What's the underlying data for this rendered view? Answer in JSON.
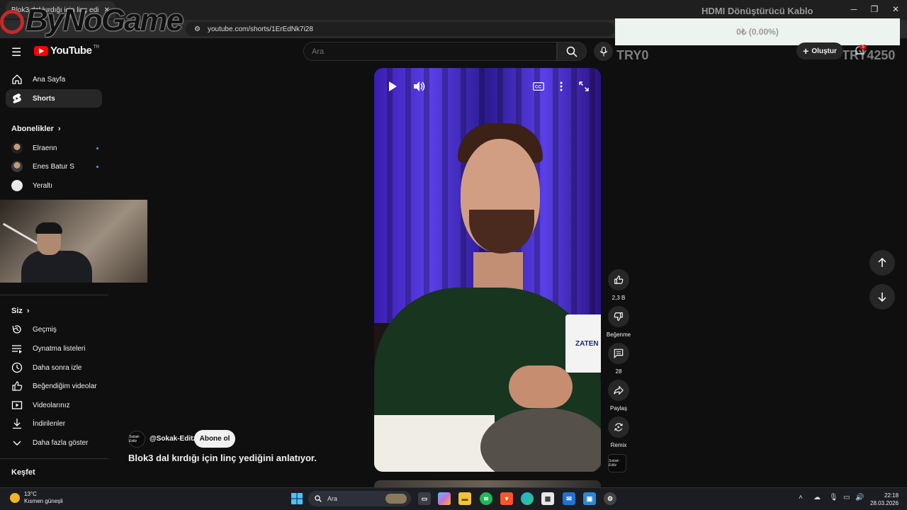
{
  "browser": {
    "tab_title": "Blok3 dal kırdığı için linç edi",
    "url": "youtube.com/shorts/1ErEdNk7i28",
    "window_controls": [
      "minimize-icon",
      "restore-icon",
      "close-icon"
    ]
  },
  "overlay": {
    "watermark": "ByNoGame",
    "product_title": "HDMI Dönüştürücü Kablo",
    "price": "0₺ (0.00%)",
    "left_label": "TRY0",
    "right_label": "TRY4250"
  },
  "youtube": {
    "logo": "YouTube",
    "region": "TR",
    "search_placeholder": "Ara",
    "create_label": "Oluştur",
    "notifications_count": "5"
  },
  "sidebar": {
    "main": [
      {
        "label": "Ana Sayfa",
        "icon": "home-icon"
      },
      {
        "label": "Shorts",
        "icon": "shorts-icon",
        "active": true
      }
    ],
    "subscriptions_title": "Abonelikler",
    "subscriptions": [
      {
        "label": "Elraenn",
        "new": true
      },
      {
        "label": "Enes Batur S",
        "new": true
      },
      {
        "label": "Yeraltı",
        "new": false
      }
    ],
    "you_title": "Siz",
    "you": [
      {
        "label": "Geçmiş",
        "icon": "history-icon"
      },
      {
        "label": "Oynatma listeleri",
        "icon": "playlist-icon"
      },
      {
        "label": "Daha sonra izle",
        "icon": "clock-icon"
      },
      {
        "label": "Beğendiğim videolar",
        "icon": "thumbs-up-icon"
      },
      {
        "label": "Videolarınız",
        "icon": "video-icon"
      },
      {
        "label": "İndirilenler",
        "icon": "download-icon"
      },
      {
        "label": "Daha fazla göster",
        "icon": "chevron-down-icon"
      }
    ],
    "explore_title": "Keşfet"
  },
  "short": {
    "mug_text": "ZATEN",
    "channel": "@Sokak-Editz",
    "channel_logo_text": "Sokak-Editz",
    "subscribe": "Abone ol",
    "title": "Blok3 dal kırdığı için linç yediğini anlatıyor.",
    "actions": {
      "likes": "2,3 B",
      "dislike": "Beğenme",
      "comments": "28",
      "share": "Paylaş",
      "remix": "Remix"
    }
  },
  "taskbar": {
    "temperature": "13°C",
    "weather": "Kısmen güneşli",
    "search": "Ara",
    "time": "22:18",
    "date": "28.03.2026"
  },
  "colors": {
    "accent_red": "#ff0000",
    "background": "#0f0f0f",
    "new_dot": "#3ea6ff"
  }
}
